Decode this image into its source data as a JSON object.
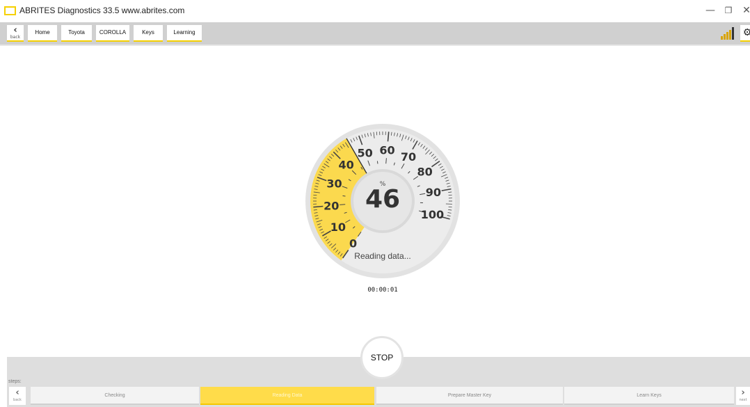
{
  "window": {
    "title": "ABRITES Diagnostics 33.5   www.abrites.com",
    "minimize": "—",
    "restore": "❐",
    "close": "✕"
  },
  "nav": {
    "back_label": "back",
    "breadcrumbs": [
      "Home",
      "Toyota",
      "COROLLA",
      "Keys",
      "Learning"
    ]
  },
  "gauge": {
    "unit": "%",
    "value": 46,
    "value_text": "46",
    "tick_labels": [
      "0",
      "10",
      "20",
      "30",
      "40",
      "50",
      "60",
      "70",
      "80",
      "90",
      "100"
    ],
    "status": "Reading data...",
    "elapsed": "00:00:01",
    "fill_color": "#fbd94e"
  },
  "actions": {
    "stop": "STOP"
  },
  "steps": {
    "label": "steps:",
    "back_label": "back",
    "next_label": "next",
    "items": [
      "Checking",
      "Reading Data",
      "Prepare Master Key",
      "Learn Keys"
    ],
    "active_index": 1
  }
}
